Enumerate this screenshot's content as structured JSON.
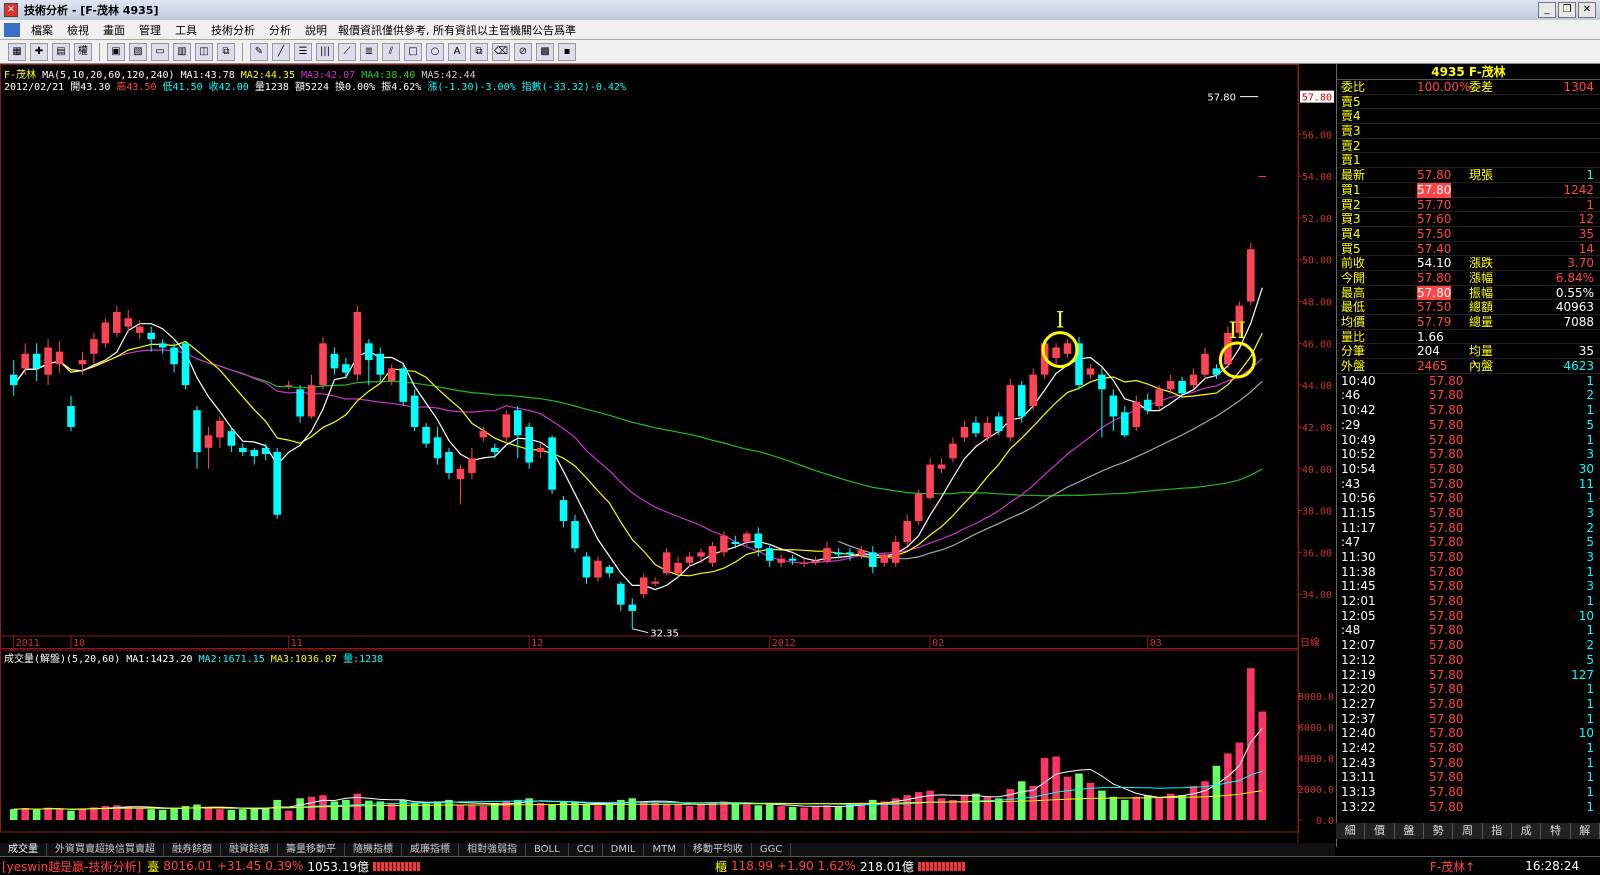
{
  "window": {
    "title": "技術分析 - [F-茂林 4935]"
  },
  "menu": {
    "items": [
      "檔案",
      "檢視",
      "畫面",
      "管理",
      "工具",
      "技術分析",
      "分析",
      "說明"
    ],
    "notice": "報價資訊僅供參考, 所有資訊以主管機關公告爲準"
  },
  "chart_info": {
    "ma_line": {
      "prefix": "F-茂林",
      "label": "MA(5,10,20,60,120,240)",
      "ma1": "MA1:43.78",
      "ma2": "MA2:44.35",
      "ma3": "MA3:42.07",
      "ma4": "MA4:38.40",
      "ma5": "MA5:42.44"
    },
    "ohlc_line": {
      "date": "2012/02/21",
      "open": "開43.30",
      "high": "高43.50",
      "low": "低41.50",
      "close": "收42.00",
      "vol": "量1238",
      "amount": "額5224",
      "turnover": "換0.00%",
      "amp": "振4.62%",
      "chg": "漲(-1.30)-3.00%",
      "index": "指數(-33.32)-0.42%"
    },
    "vol_line": {
      "label": "成交量(解盤)(5,20,60)",
      "ma1": "MA1:1423.20",
      "ma2": "MA2:1671.15",
      "ma3": "MA3:1036.07",
      "vol": "量:1238"
    },
    "period_label": "日線",
    "low_label": "32.35",
    "high_label": "57.80",
    "wave_labels": [
      "I",
      "II"
    ]
  },
  "chart_data": {
    "type": "candlestick",
    "price_axis": {
      "ylim": [
        32.35,
        57.8
      ],
      "ticks": [
        "56.00",
        "54.00",
        "52.00",
        "50.00",
        "48.00",
        "46.00",
        "44.00",
        "42.00",
        "40.00",
        "38.00",
        "36.00",
        "34.00"
      ],
      "ticks_values": [
        56,
        54,
        52,
        50,
        48,
        46,
        44,
        42,
        40,
        38,
        36,
        34
      ]
    },
    "volume_axis": {
      "ticks": [
        "8000.0",
        "6000.0",
        "4000.0",
        "2000.0",
        "0.0"
      ],
      "ticks_values": [
        8000,
        6000,
        4000,
        2000,
        0
      ]
    },
    "time_labels": [
      "2011",
      "10",
      "11",
      "12",
      "2012",
      "02",
      "03"
    ],
    "time_label_bars": [
      0,
      5,
      24,
      45,
      66,
      80,
      99
    ],
    "current_price": "57.80",
    "candles": [
      [
        44.5,
        44.0,
        45.2,
        43.5
      ],
      [
        44.8,
        45.5,
        46.0,
        44.5
      ],
      [
        45.5,
        44.8,
        46.0,
        44.2
      ],
      [
        44.5,
        45.8,
        46.2,
        44.0
      ],
      [
        45.0,
        45.6,
        46.1,
        44.6
      ],
      [
        43.0,
        42.0,
        43.5,
        41.8
      ],
      [
        45.0,
        45.2,
        45.6,
        44.5
      ],
      [
        45.5,
        46.2,
        46.5,
        45.0
      ],
      [
        46.0,
        47.0,
        47.2,
        45.8
      ],
      [
        46.5,
        47.5,
        47.8,
        46.3
      ],
      [
        46.8,
        47.2,
        47.6,
        46.5
      ],
      [
        46.5,
        46.8,
        47.1,
        46.2
      ],
      [
        46.5,
        46.2,
        46.8,
        45.6
      ],
      [
        46.0,
        45.8,
        46.2,
        45.5
      ],
      [
        45.8,
        45.0,
        46.0,
        44.6
      ],
      [
        46.0,
        44.0,
        46.1,
        43.8
      ],
      [
        42.8,
        40.8,
        43.0,
        40.0
      ],
      [
        41.0,
        41.6,
        42.0,
        40.0
      ],
      [
        41.5,
        42.3,
        42.5,
        41.0
      ],
      [
        41.8,
        41.1,
        42.0,
        40.8
      ],
      [
        41.0,
        40.8,
        41.2,
        40.6
      ],
      [
        40.9,
        40.6,
        41.0,
        40.2
      ],
      [
        41.0,
        40.7,
        41.2,
        40.4
      ],
      [
        40.8,
        37.8,
        41.0,
        37.6
      ],
      [
        44.0,
        44.0,
        44.2,
        43.8
      ],
      [
        43.8,
        42.5,
        44.0,
        42.2
      ],
      [
        42.5,
        44.0,
        44.5,
        42.4
      ],
      [
        44.0,
        46.0,
        46.3,
        43.8
      ],
      [
        45.5,
        44.8,
        45.8,
        44.5
      ],
      [
        45.0,
        44.6,
        45.3,
        44.3
      ],
      [
        44.5,
        47.5,
        47.8,
        44.2
      ],
      [
        46.0,
        45.2,
        46.2,
        44.0
      ],
      [
        45.5,
        44.5,
        45.8,
        44.2
      ],
      [
        44.2,
        44.8,
        45.0,
        44.0
      ],
      [
        44.8,
        43.2,
        45.0,
        43.0
      ],
      [
        43.5,
        42.0,
        43.8,
        41.8
      ],
      [
        42.0,
        41.2,
        42.2,
        41.0
      ],
      [
        41.5,
        40.5,
        42.0,
        40.2
      ],
      [
        40.8,
        39.8,
        41.0,
        39.5
      ],
      [
        39.5,
        40.0,
        40.2,
        38.3
      ],
      [
        39.8,
        40.5,
        41.0,
        39.5
      ],
      [
        41.5,
        41.8,
        42.0,
        41.3
      ],
      [
        41.0,
        40.8,
        41.2,
        40.5
      ],
      [
        41.5,
        42.6,
        42.8,
        41.3
      ],
      [
        42.8,
        41.6,
        43.0,
        40.5
      ],
      [
        42.0,
        40.3,
        42.2,
        40.0
      ],
      [
        40.8,
        41.0,
        41.2,
        40.5
      ],
      [
        41.5,
        39.0,
        41.6,
        38.8
      ],
      [
        38.5,
        37.5,
        38.7,
        37.2
      ],
      [
        37.5,
        36.2,
        37.8,
        36.0
      ],
      [
        35.8,
        34.8,
        36.0,
        34.5
      ],
      [
        34.8,
        35.6,
        35.8,
        34.6
      ],
      [
        35.3,
        35.0,
        35.4,
        34.8
      ],
      [
        34.5,
        33.5,
        34.6,
        33.2
      ],
      [
        33.5,
        33.2,
        33.8,
        32.35
      ],
      [
        34.0,
        34.8,
        35.0,
        33.8
      ],
      [
        34.5,
        34.6,
        34.8,
        34.4
      ],
      [
        35.0,
        36.0,
        36.2,
        34.9
      ],
      [
        35.0,
        35.5,
        35.8,
        34.8
      ],
      [
        35.5,
        35.8,
        36.0,
        35.3
      ],
      [
        35.8,
        36.0,
        36.2,
        35.5
      ],
      [
        35.5,
        36.3,
        36.5,
        35.3
      ],
      [
        36.0,
        36.8,
        37.0,
        35.8
      ],
      [
        36.5,
        36.4,
        36.8,
        36.2
      ],
      [
        36.5,
        36.9,
        37.0,
        36.3
      ],
      [
        36.9,
        36.2,
        37.2,
        35.8
      ],
      [
        36.2,
        35.6,
        36.4,
        35.3
      ],
      [
        35.5,
        35.7,
        35.9,
        35.3
      ],
      [
        35.7,
        35.6,
        35.9,
        35.4
      ],
      [
        35.5,
        35.5,
        35.7,
        35.3
      ],
      [
        35.5,
        35.6,
        35.8,
        35.4
      ],
      [
        35.6,
        36.2,
        36.5,
        35.5
      ],
      [
        36.0,
        35.9,
        36.2,
        35.7
      ],
      [
        36.0,
        35.9,
        36.2,
        35.6
      ],
      [
        35.9,
        36.1,
        36.3,
        35.7
      ],
      [
        36.0,
        35.3,
        36.3,
        35.0
      ],
      [
        35.5,
        35.9,
        36.0,
        35.3
      ],
      [
        35.5,
        36.5,
        36.8,
        35.3
      ],
      [
        36.5,
        37.5,
        37.8,
        36.3
      ],
      [
        37.5,
        38.8,
        39.0,
        37.3
      ],
      [
        38.6,
        40.2,
        40.5,
        38.5
      ],
      [
        40.0,
        40.2,
        40.5,
        39.8
      ],
      [
        40.5,
        41.2,
        41.5,
        40.3
      ],
      [
        41.5,
        42.0,
        42.3,
        41.3
      ],
      [
        42.2,
        41.7,
        42.5,
        41.5
      ],
      [
        41.5,
        42.2,
        42.5,
        41.3
      ],
      [
        42.5,
        41.8,
        42.7,
        41.6
      ],
      [
        41.5,
        44.0,
        44.3,
        41.3
      ],
      [
        44.0,
        42.5,
        44.2,
        42.2
      ],
      [
        43.0,
        44.5,
        44.8,
        42.8
      ],
      [
        44.5,
        46.0,
        46.2,
        44.3
      ],
      [
        45.3,
        45.8,
        46.0,
        45.0
      ],
      [
        45.5,
        46.0,
        46.2,
        45.3
      ],
      [
        46.0,
        44.0,
        46.3,
        43.8
      ],
      [
        44.5,
        44.8,
        45.0,
        44.3
      ],
      [
        44.5,
        43.8,
        44.8,
        41.5
      ],
      [
        43.5,
        42.5,
        43.8,
        41.8
      ],
      [
        42.7,
        41.6,
        43.0,
        41.5
      ],
      [
        42.0,
        43.2,
        43.5,
        41.8
      ],
      [
        43.3,
        42.8,
        43.6,
        42.6
      ],
      [
        43.0,
        43.8,
        44.0,
        42.8
      ],
      [
        43.8,
        44.2,
        44.5,
        43.6
      ],
      [
        44.2,
        43.6,
        44.4,
        43.5
      ],
      [
        44.0,
        44.5,
        44.8,
        43.8
      ],
      [
        44.5,
        45.5,
        45.8,
        44.3
      ],
      [
        44.8,
        44.5,
        45.0,
        44.3
      ],
      [
        45.0,
        46.5,
        46.8,
        44.8
      ],
      [
        46.5,
        47.8,
        48.0,
        46.3
      ],
      [
        48.0,
        50.5,
        50.8,
        47.8
      ],
      [
        54.0,
        54.0,
        54.0,
        54.0
      ]
    ],
    "volumes": [
      700,
      750,
      650,
      800,
      700,
      600,
      750,
      820,
      900,
      950,
      850,
      780,
      700,
      650,
      750,
      900,
      1000,
      800,
      700,
      650,
      700,
      750,
      800,
      1300,
      600,
      1400,
      1500,
      1600,
      1200,
      1300,
      1700,
      1250,
      1200,
      1100,
      1300,
      1100,
      1050,
      1200,
      1300,
      1000,
      950,
      900,
      1100,
      1250,
      1300,
      1400,
      1100,
      1000,
      1200,
      1150,
      1000,
      950,
      1100,
      1300,
      1400,
      1200,
      1100,
      1050,
      1000,
      900,
      1000,
      1100,
      1200,
      1050,
      1000,
      950,
      1000,
      900,
      850,
      800,
      900,
      950,
      850,
      1000,
      1100,
      1300,
      1200,
      1400,
      1600,
      1800,
      1900,
      1400,
      1300,
      1600,
      1700,
      1500,
      1400,
      2000,
      2500,
      2200,
      4000,
      4100,
      2800,
      3000,
      2400,
      1900,
      1500,
      1300,
      1500,
      1600,
      1400,
      1700,
      1600,
      2200,
      2500,
      3500,
      4300,
      5000,
      9800,
      7000
    ]
  },
  "quote": {
    "header": "4935 F-茂林",
    "weibi": {
      "label": "委比",
      "value": "100.00%",
      "label2": "委差",
      "value2": "1304"
    },
    "asks": [
      "賣5",
      "賣4",
      "賣3",
      "賣2",
      "賣1"
    ],
    "latest": {
      "label": "最新",
      "price": "57.80",
      "label2": "現張",
      "qty": "1"
    },
    "bids": [
      {
        "label": "買1",
        "price": "57.80",
        "qty": "1242"
      },
      {
        "label": "買2",
        "price": "57.70",
        "qty": "1"
      },
      {
        "label": "買3",
        "price": "57.60",
        "qty": "12"
      },
      {
        "label": "買4",
        "price": "57.50",
        "qty": "35"
      },
      {
        "label": "買5",
        "price": "57.40",
        "qty": "14"
      }
    ],
    "stats": [
      {
        "l1": "前收",
        "v1": "54.10",
        "l2": "漲跌",
        "v2": "3.70"
      },
      {
        "l1": "今開",
        "v1": "57.80",
        "l2": "漲幅",
        "v2": "6.84%"
      },
      {
        "l1": "最高",
        "v1": "57.80",
        "l2": "振幅",
        "v2": "0.55%"
      },
      {
        "l1": "最低",
        "v1": "57.50",
        "l2": "總額",
        "v2": "40963"
      },
      {
        "l1": "均價",
        "v1": "57.79",
        "l2": "總量",
        "v2": "7088"
      },
      {
        "l1": "量比",
        "v1": "1.66",
        "l2": "",
        "v2": ""
      },
      {
        "l1": "分筆",
        "v1": "204",
        "l2": "均量",
        "v2": "35"
      },
      {
        "l1": "外盤",
        "v1": "2465",
        "l2": "內盤",
        "v2": "4623"
      }
    ],
    "ticks": [
      {
        "t": "10:40",
        "p": "57.80",
        "q": "1"
      },
      {
        "t": ":46",
        "p": "57.80",
        "q": "2"
      },
      {
        "t": "10:42",
        "p": "57.80",
        "q": "1"
      },
      {
        "t": ":29",
        "p": "57.80",
        "q": "5"
      },
      {
        "t": "10:49",
        "p": "57.80",
        "q": "1"
      },
      {
        "t": "10:52",
        "p": "57.80",
        "q": "3"
      },
      {
        "t": "10:54",
        "p": "57.80",
        "q": "30"
      },
      {
        "t": ":43",
        "p": "57.80",
        "q": "11"
      },
      {
        "t": "10:56",
        "p": "57.80",
        "q": "1"
      },
      {
        "t": "11:15",
        "p": "57.80",
        "q": "3"
      },
      {
        "t": "11:17",
        "p": "57.80",
        "q": "2"
      },
      {
        "t": ":47",
        "p": "57.80",
        "q": "5"
      },
      {
        "t": "11:30",
        "p": "57.80",
        "q": "3"
      },
      {
        "t": "11:38",
        "p": "57.80",
        "q": "1"
      },
      {
        "t": "11:45",
        "p": "57.80",
        "q": "3"
      },
      {
        "t": "12:01",
        "p": "57.80",
        "q": "1"
      },
      {
        "t": "12:05",
        "p": "57.80",
        "q": "10"
      },
      {
        "t": ":48",
        "p": "57.80",
        "q": "1"
      },
      {
        "t": "12:07",
        "p": "57.80",
        "q": "2"
      },
      {
        "t": "12:12",
        "p": "57.80",
        "q": "5"
      },
      {
        "t": "12:19",
        "p": "57.80",
        "q": "127"
      },
      {
        "t": "12:20",
        "p": "57.80",
        "q": "1"
      },
      {
        "t": "12:27",
        "p": "57.80",
        "q": "1"
      },
      {
        "t": "12:37",
        "p": "57.80",
        "q": "1"
      },
      {
        "t": "12:40",
        "p": "57.80",
        "q": "10"
      },
      {
        "t": "12:42",
        "p": "57.80",
        "q": "1"
      },
      {
        "t": "12:43",
        "p": "57.80",
        "q": "1"
      },
      {
        "t": "13:11",
        "p": "57.80",
        "q": "1"
      },
      {
        "t": "13:13",
        "p": "57.80",
        "q": "1"
      },
      {
        "t": "13:22",
        "p": "57.80",
        "q": "1"
      }
    ],
    "tabs": [
      "細",
      "價",
      "盤",
      "勢",
      "周",
      "指",
      "成",
      "特",
      "解"
    ]
  },
  "indicator_tabs": [
    "成交量",
    "外資買賣超換信買賣超",
    "融券餘額",
    "融資餘額",
    "籌量移動平",
    "隨機指標",
    "威廉指標",
    "相對強弱指",
    "BOLL",
    "CCI",
    "DMIL",
    "MTM",
    "移動平均收",
    "GGC"
  ],
  "status": {
    "app": "[yeswin越是贏-技術分析]",
    "twse_label": "臺",
    "twse_index": "8016.01",
    "twse_chg": "+31.45",
    "twse_pct": "0.39%",
    "twse_amt": "1053.19億",
    "otc_label": "櫃",
    "otc_index": "118.99",
    "otc_chg": "+1.90",
    "otc_pct": "1.62%",
    "otc_amt": "218.01億",
    "symbol": "F-茂林↑",
    "time": "16:28:24"
  },
  "colors": {
    "up": "#ff4455",
    "down": "#00ffff",
    "ma5": "#ffffff",
    "ma10": "#ffff00",
    "ma20": "#cc33cc",
    "ma60": "#22bb22",
    "ma120": "#aaaaaa",
    "vol_up": "#ff3366",
    "vol_down": "#66ff66",
    "circle": "#ffff00"
  }
}
